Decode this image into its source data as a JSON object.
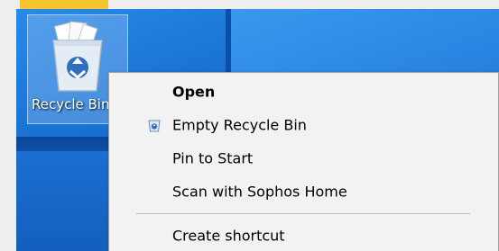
{
  "desktop": {
    "icon": {
      "label": "Recycle Bin",
      "icon_name": "recycle-bin-icon"
    }
  },
  "context_menu": {
    "items": [
      {
        "label": "Open",
        "bold": true
      },
      {
        "label": "Empty Recycle Bin",
        "icon_name": "recycle-icon"
      },
      {
        "label": "Pin to Start"
      },
      {
        "label": "Scan with Sophos Home"
      },
      {
        "label": "Create shortcut"
      }
    ]
  },
  "colors": {
    "desktop_blue": "#1468c6",
    "menu_background": "#f2f2f2",
    "accent_yellow": "#f6c42c"
  }
}
